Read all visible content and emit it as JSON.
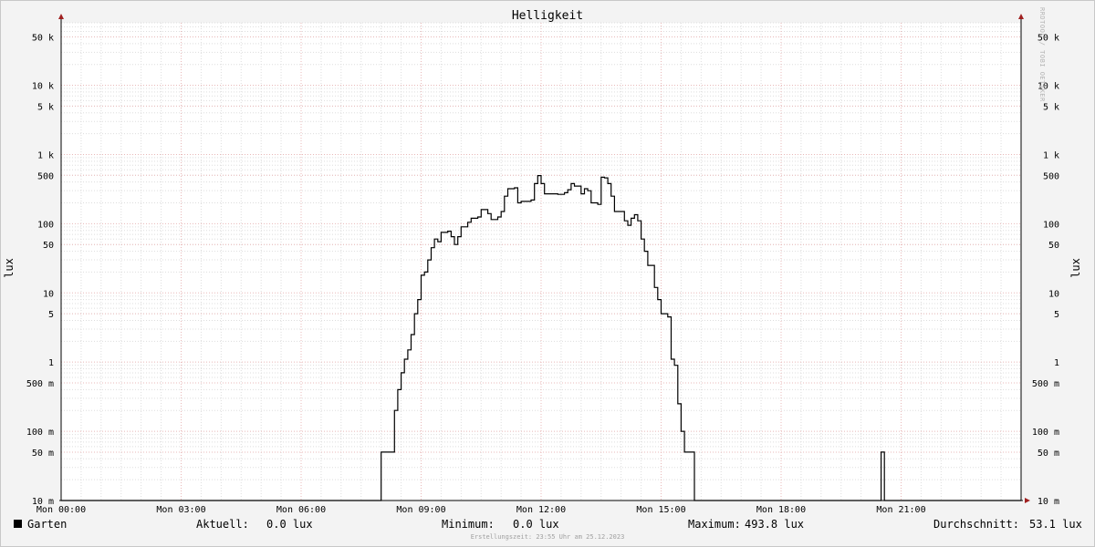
{
  "chart_data": {
    "type": "line",
    "title": "Helligkeit",
    "ylabel": "lux",
    "yscale": "log",
    "ylim": [
      0.01,
      80000
    ],
    "xlim": [
      "Mon 00:00",
      "Tue 00:00"
    ],
    "y_ticks": [
      {
        "value": 50000,
        "label": "50 k"
      },
      {
        "value": 10000,
        "label": "10 k"
      },
      {
        "value": 5000,
        "label": "5 k"
      },
      {
        "value": 1000,
        "label": "1 k"
      },
      {
        "value": 500,
        "label": "500"
      },
      {
        "value": 100,
        "label": "100"
      },
      {
        "value": 50,
        "label": "50"
      },
      {
        "value": 10,
        "label": "10"
      },
      {
        "value": 5,
        "label": "5"
      },
      {
        "value": 1,
        "label": "1"
      },
      {
        "value": 0.5,
        "label": "500 m"
      },
      {
        "value": 0.1,
        "label": "100 m"
      },
      {
        "value": 0.05,
        "label": "50 m"
      },
      {
        "value": 0.01,
        "label": "10 m"
      }
    ],
    "x_ticks": [
      {
        "time": "00:00",
        "label": "Mon 00:00"
      },
      {
        "time": "03:00",
        "label": "Mon 03:00"
      },
      {
        "time": "06:00",
        "label": "Mon 06:00"
      },
      {
        "time": "09:00",
        "label": "Mon 09:00"
      },
      {
        "time": "12:00",
        "label": "Mon 12:00"
      },
      {
        "time": "15:00",
        "label": "Mon 15:00"
      },
      {
        "time": "18:00",
        "label": "Mon 18:00"
      },
      {
        "time": "21:00",
        "label": "Mon 21:00"
      }
    ],
    "series": [
      {
        "name": "Garten",
        "color": "#000000",
        "step": true,
        "points": [
          [
            "00:00",
            0
          ],
          [
            "08:00",
            0
          ],
          [
            "08:00",
            0.05
          ],
          [
            "08:15",
            0.05
          ],
          [
            "08:20",
            0.2
          ],
          [
            "08:25",
            0.4
          ],
          [
            "08:30",
            0.7
          ],
          [
            "08:35",
            1.1
          ],
          [
            "08:40",
            1.5
          ],
          [
            "08:45",
            2.5
          ],
          [
            "08:50",
            5
          ],
          [
            "08:55",
            8
          ],
          [
            "09:00",
            18
          ],
          [
            "09:05",
            20
          ],
          [
            "09:10",
            30
          ],
          [
            "09:15",
            45
          ],
          [
            "09:20",
            60
          ],
          [
            "09:25",
            55
          ],
          [
            "09:30",
            75
          ],
          [
            "09:40",
            78
          ],
          [
            "09:45",
            65
          ],
          [
            "09:50",
            50
          ],
          [
            "09:55",
            65
          ],
          [
            "10:00",
            90
          ],
          [
            "10:10",
            105
          ],
          [
            "10:15",
            120
          ],
          [
            "10:25",
            125
          ],
          [
            "10:30",
            160
          ],
          [
            "10:40",
            140
          ],
          [
            "10:45",
            115
          ],
          [
            "10:55",
            125
          ],
          [
            "11:00",
            150
          ],
          [
            "11:05",
            250
          ],
          [
            "11:10",
            320
          ],
          [
            "11:20",
            330
          ],
          [
            "11:25",
            200
          ],
          [
            "11:30",
            210
          ],
          [
            "11:45",
            220
          ],
          [
            "11:50",
            380
          ],
          [
            "11:55",
            495
          ],
          [
            "12:00",
            380
          ],
          [
            "12:05",
            270
          ],
          [
            "12:25",
            265
          ],
          [
            "12:35",
            280
          ],
          [
            "12:40",
            310
          ],
          [
            "12:45",
            380
          ],
          [
            "12:50",
            350
          ],
          [
            "13:00",
            270
          ],
          [
            "13:05",
            320
          ],
          [
            "13:10",
            300
          ],
          [
            "13:15",
            200
          ],
          [
            "13:25",
            190
          ],
          [
            "13:30",
            470
          ],
          [
            "13:35",
            460
          ],
          [
            "13:40",
            380
          ],
          [
            "13:45",
            250
          ],
          [
            "13:50",
            150
          ],
          [
            "14:00",
            150
          ],
          [
            "14:05",
            110
          ],
          [
            "14:10",
            95
          ],
          [
            "14:15",
            120
          ],
          [
            "14:20",
            135
          ],
          [
            "14:25",
            110
          ],
          [
            "14:30",
            60
          ],
          [
            "14:35",
            40
          ],
          [
            "14:40",
            25
          ],
          [
            "14:50",
            12
          ],
          [
            "14:55",
            8
          ],
          [
            "15:00",
            5
          ],
          [
            "15:10",
            4.5
          ],
          [
            "15:15",
            1.1
          ],
          [
            "15:20",
            0.9
          ],
          [
            "15:25",
            0.25
          ],
          [
            "15:30",
            0.1
          ],
          [
            "15:35",
            0.05
          ],
          [
            "15:50",
            0.05
          ],
          [
            "15:50",
            0
          ],
          [
            "20:30",
            0
          ],
          [
            "20:30",
            0.05
          ],
          [
            "20:35",
            0.05
          ],
          [
            "20:35",
            0
          ],
          [
            "24:00",
            0
          ]
        ]
      }
    ],
    "legend": "bottom",
    "grid": true
  },
  "legend": {
    "series_name": "Garten",
    "current_label": "Aktuell:",
    "current_value": "0.0 lux",
    "min_label": "Minimum:",
    "min_value": "0.0 lux",
    "max_label": "Maximum:",
    "max_value": "493.8 lux",
    "avg_label": "Durchschnitt:",
    "avg_value": "53.1 lux"
  },
  "footer": "Erstellungszeit: 23:55 Uhr am 25.12.2023",
  "watermark": "RRDTOOL / TOBI OETIKER"
}
